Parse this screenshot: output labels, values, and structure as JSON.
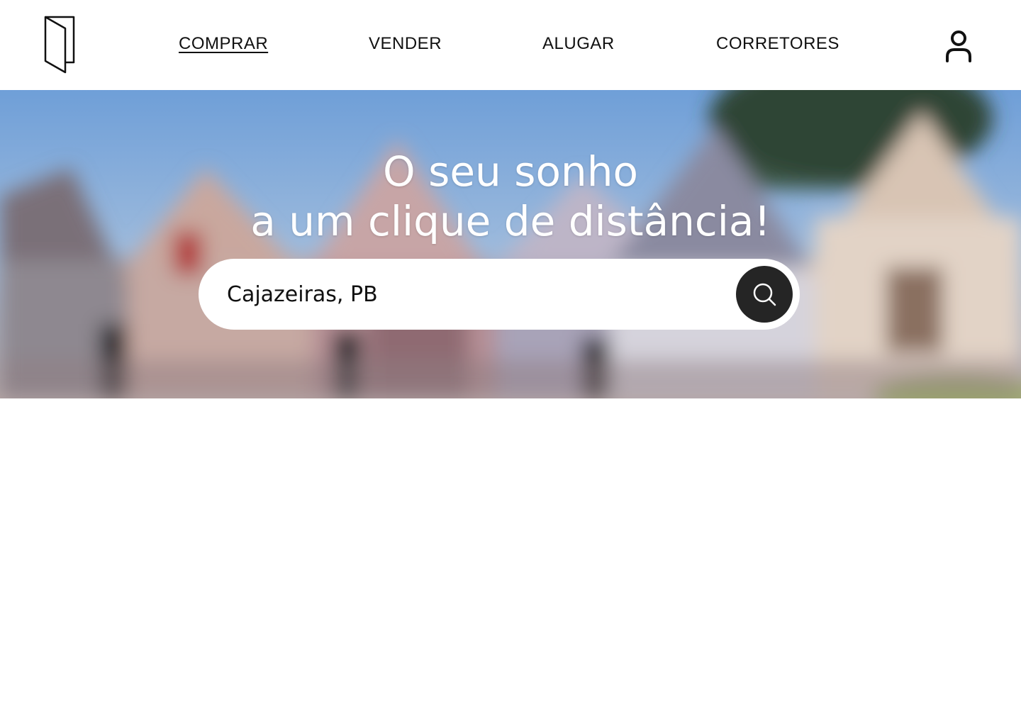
{
  "header": {
    "nav": [
      {
        "label": "COMPRAR",
        "active": true
      },
      {
        "label": "VENDER",
        "active": false
      },
      {
        "label": "ALUGAR",
        "active": false
      },
      {
        "label": "CORRETORES",
        "active": false
      }
    ],
    "logo_icon": "door-logo-icon",
    "user_icon": "user-icon"
  },
  "hero": {
    "title_line1": "O seu sonho",
    "title_line2": "a um clique de distância!",
    "background": "blurred-houses-photo",
    "search": {
      "value": "Cajazeiras, PB",
      "button_icon": "search-icon"
    }
  },
  "colors": {
    "button_bg": "#252525",
    "text": "#111111",
    "hero_text": "#ffffff"
  }
}
